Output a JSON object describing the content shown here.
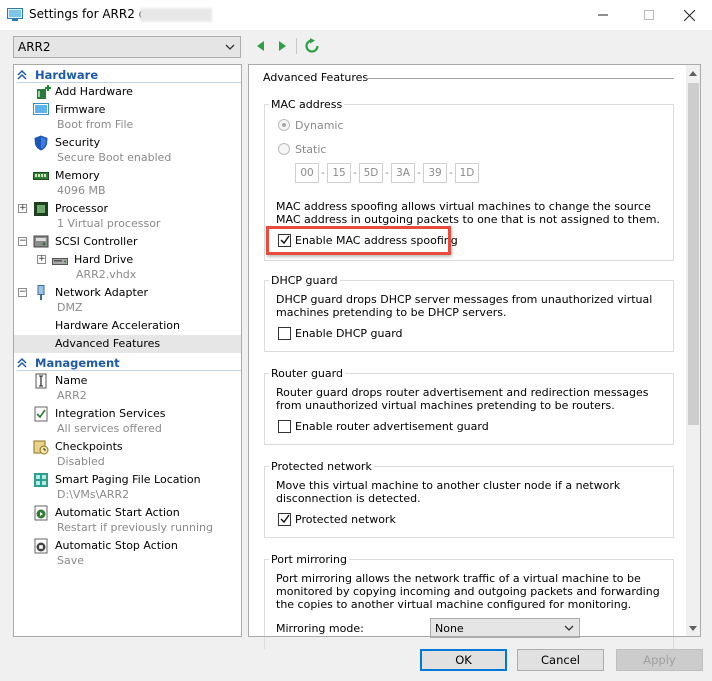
{
  "window": {
    "title": "Settings for ARR2 on",
    "minimize_icon": "minimize-icon",
    "maximize_icon": "maximize-icon",
    "close_icon": "close-icon"
  },
  "toolbar": {
    "vm_selected": "ARR2"
  },
  "tree": {
    "hardware_header": "Hardware",
    "management_header": "Management",
    "items": [
      {
        "label": "Add Hardware",
        "sub": ""
      },
      {
        "label": "Firmware",
        "sub": "Boot from File"
      },
      {
        "label": "Security",
        "sub": "Secure Boot enabled"
      },
      {
        "label": "Memory",
        "sub": "4096 MB"
      },
      {
        "label": "Processor",
        "sub": "1 Virtual processor"
      },
      {
        "label": "SCSI Controller",
        "sub": ""
      },
      {
        "label": "Hard Drive",
        "sub": "ARR2.vhdx"
      },
      {
        "label": "Network Adapter",
        "sub": "DMZ"
      },
      {
        "label": "Hardware Acceleration",
        "sub": ""
      },
      {
        "label": "Advanced Features",
        "sub": ""
      }
    ],
    "mgmt_items": [
      {
        "label": "Name",
        "sub": "ARR2"
      },
      {
        "label": "Integration Services",
        "sub": "All services offered"
      },
      {
        "label": "Checkpoints",
        "sub": "Disabled"
      },
      {
        "label": "Smart Paging File Location",
        "sub": "D:\\VMs\\ARR2"
      },
      {
        "label": "Automatic Start Action",
        "sub": "Restart if previously running"
      },
      {
        "label": "Automatic Stop Action",
        "sub": "Save"
      }
    ]
  },
  "content": {
    "title": "Advanced Features",
    "mac": {
      "title": "MAC address",
      "dynamic": "Dynamic",
      "static": "Static",
      "octets": [
        "00",
        "15",
        "5D",
        "3A",
        "39",
        "1D"
      ],
      "spoof_desc": "MAC address spoofing allows virtual machines to change the source MAC address in outgoing packets to one that is not assigned to them.",
      "spoof_label": "Enable MAC address spoofing",
      "spoof_checked": true
    },
    "dhcp": {
      "title": "DHCP guard",
      "desc": "DHCP guard drops DHCP server messages from unauthorized virtual machines pretending to be DHCP servers.",
      "label": "Enable DHCP guard",
      "checked": false
    },
    "router": {
      "title": "Router guard",
      "desc": "Router guard drops router advertisement and redirection messages from unauthorized virtual machines pretending to be routers.",
      "label": "Enable router advertisement guard",
      "checked": false
    },
    "protected": {
      "title": "Protected network",
      "desc": "Move this virtual machine to another cluster node if a network disconnection is detected.",
      "label": "Protected network",
      "checked": true
    },
    "mirroring": {
      "title": "Port mirroring",
      "desc": "Port mirroring allows the network traffic of a virtual machine to be monitored by copying incoming and outgoing packets and forwarding the copies to another virtual machine configured for monitoring.",
      "mode_label": "Mirroring mode:",
      "mode_value": "None"
    }
  },
  "buttons": {
    "ok": "OK",
    "cancel": "Cancel",
    "apply": "Apply"
  },
  "colors": {
    "section_header": "#1e5aa8",
    "highlight": "#e84c3d",
    "nav_green": "#2ea043"
  }
}
